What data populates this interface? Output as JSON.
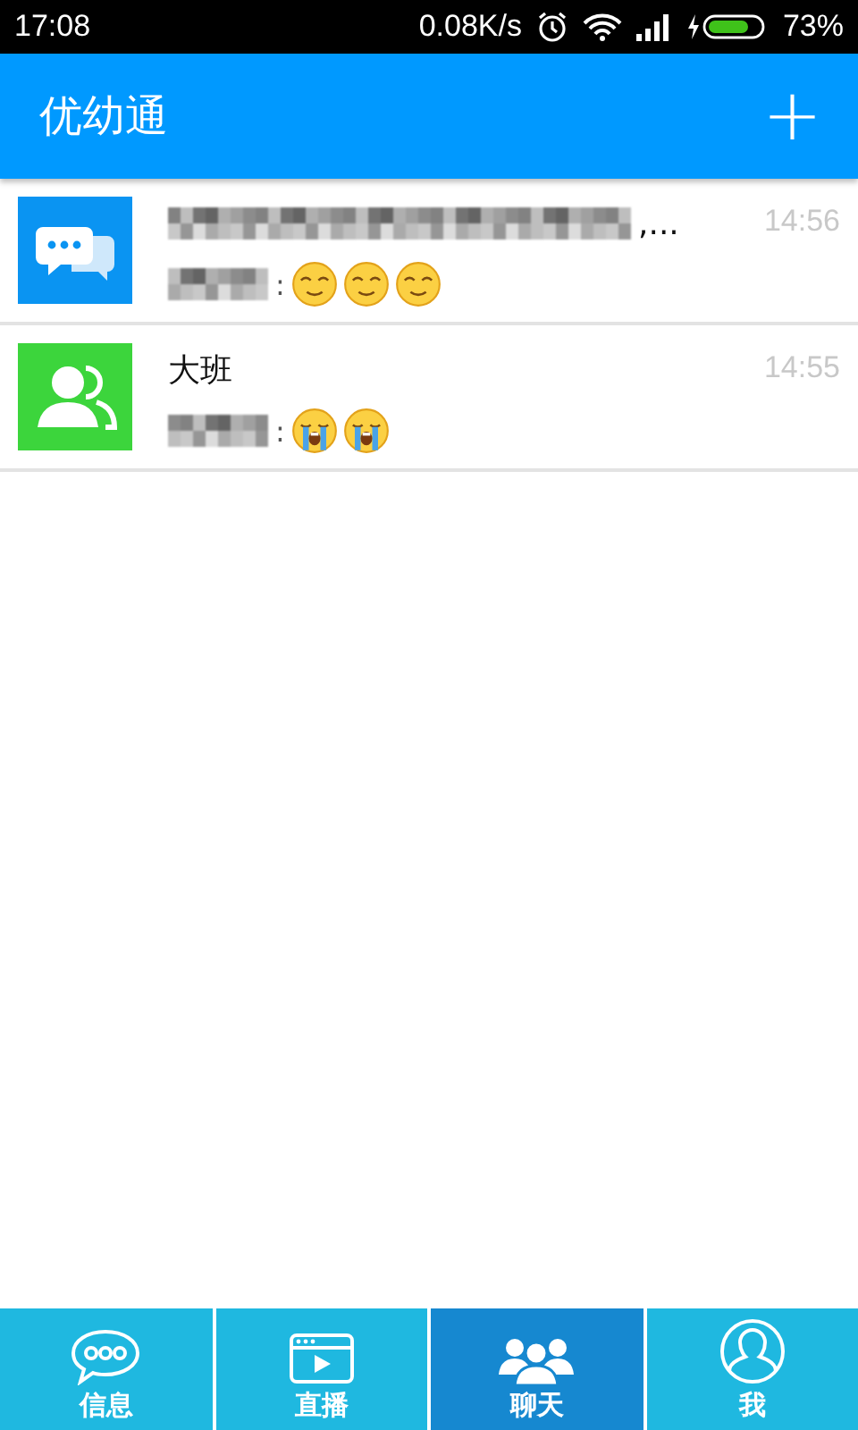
{
  "status_bar": {
    "time": "17:08",
    "speed": "0.08K/s",
    "battery": "73%"
  },
  "app_bar": {
    "title": "优幼通",
    "action": "+"
  },
  "conversations": [
    {
      "kind": "chat",
      "title_redacted": true,
      "title_tail": ",...",
      "time": "14:56",
      "sender_redacted": true,
      "separator": ":",
      "emojis": [
        {
          "kind": "relieved"
        },
        {
          "kind": "relieved"
        },
        {
          "kind": "relieved"
        }
      ]
    },
    {
      "kind": "group",
      "title": "大班",
      "time": "14:55",
      "sender_redacted": true,
      "separator": ":",
      "emojis": [
        {
          "kind": "crying"
        },
        {
          "kind": "crying"
        }
      ]
    }
  ],
  "tabs": [
    {
      "kind": "speech",
      "label": "信息",
      "selected": false
    },
    {
      "kind": "video",
      "label": "直播",
      "selected": false
    },
    {
      "kind": "people",
      "label": "聊天",
      "selected": true
    },
    {
      "kind": "person",
      "label": "我",
      "selected": false
    }
  ]
}
